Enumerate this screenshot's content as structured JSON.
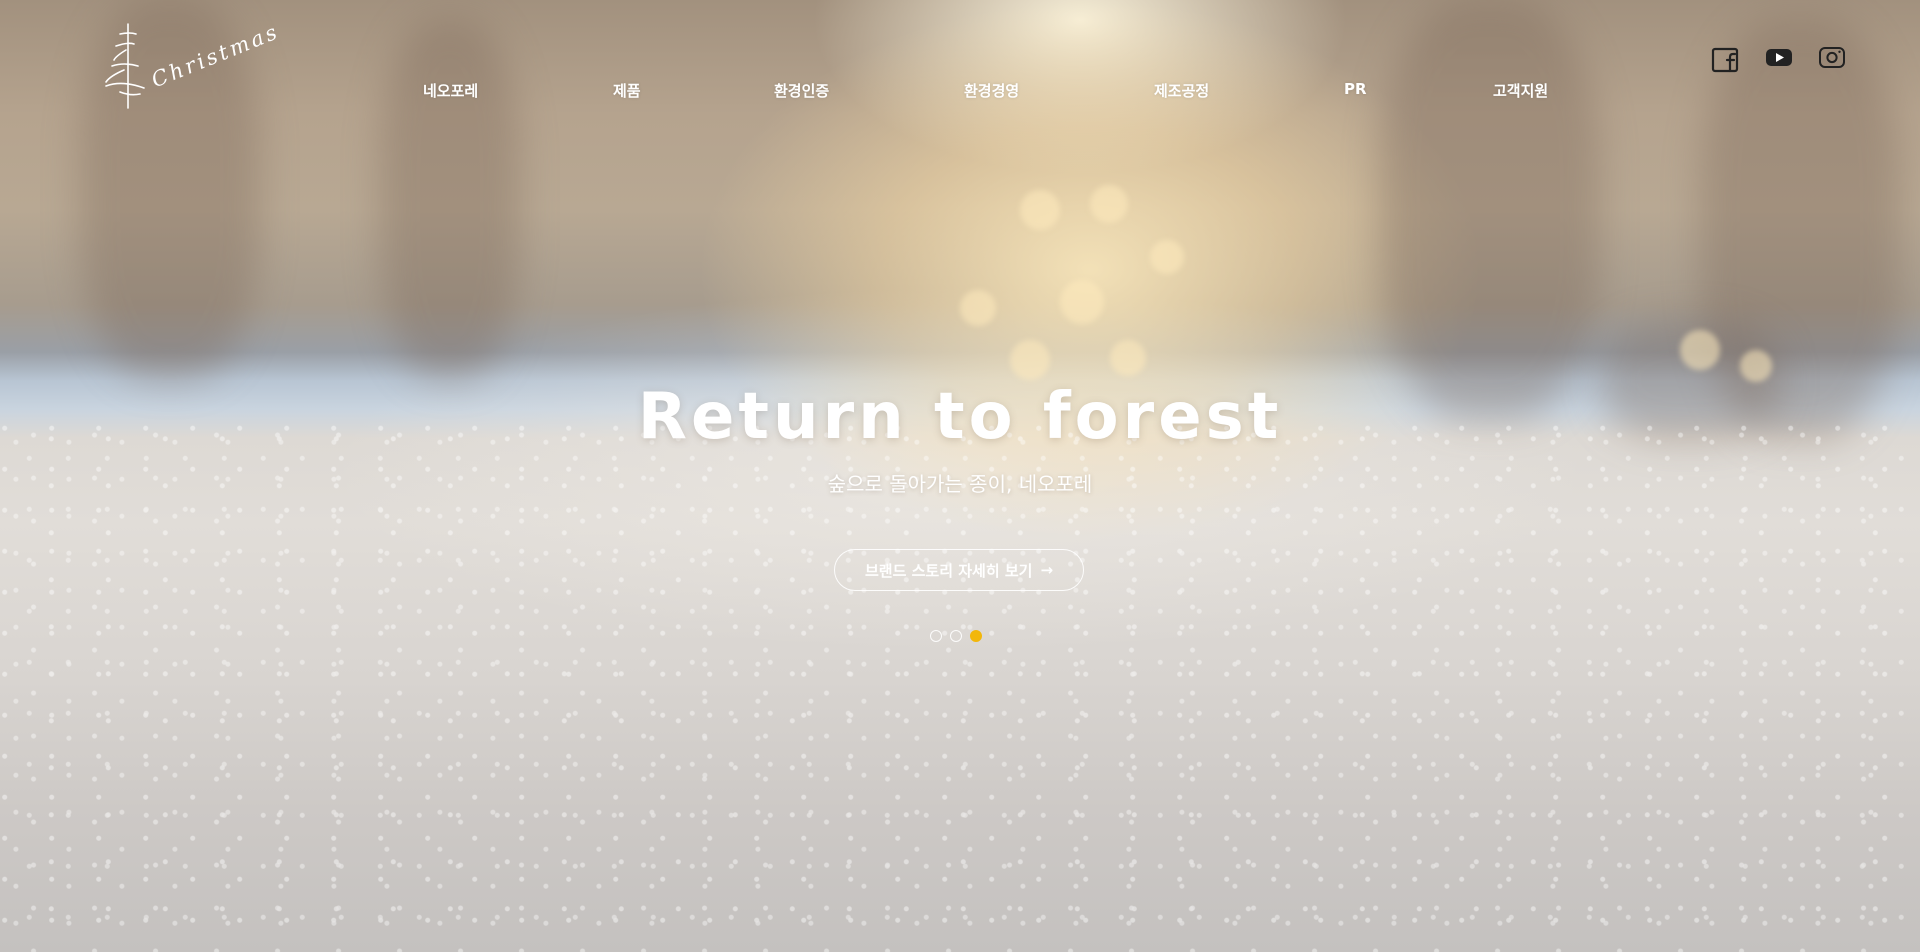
{
  "logo": {
    "text": "Christmas"
  },
  "nav": {
    "items": [
      {
        "label": "네오포레"
      },
      {
        "label": "제품"
      },
      {
        "label": "환경인증"
      },
      {
        "label": "환경경영"
      },
      {
        "label": "제조공정"
      },
      {
        "label": "PR"
      },
      {
        "label": "고객지원"
      }
    ]
  },
  "social": {
    "icons": [
      "facebook-icon",
      "youtube-icon",
      "instagram-icon"
    ]
  },
  "hero": {
    "title": "Return to forest",
    "subtitle": "숲으로 돌아가는 종이, 네오포레",
    "cta_label": "브랜드 스토리 자세히 보기",
    "cta_arrow": "→",
    "slide_count": 3,
    "active_slide": 3,
    "accent_color": "#f2b70b"
  }
}
